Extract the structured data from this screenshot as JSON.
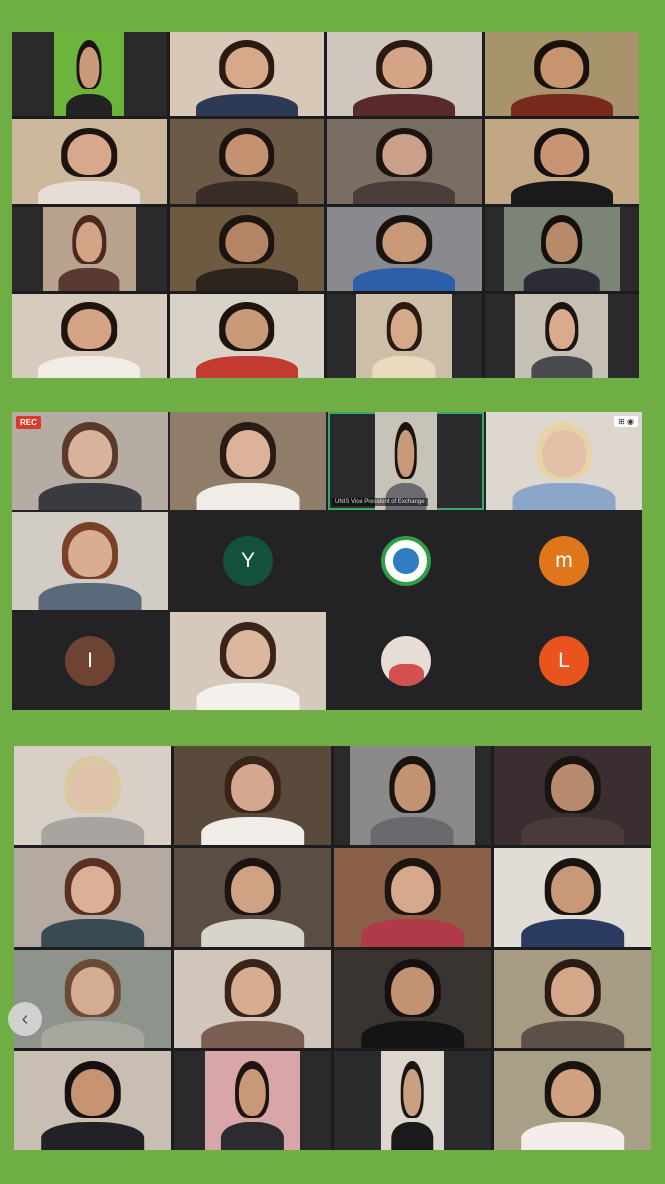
{
  "panels": [
    {
      "tiles": [
        {
          "bg": "#2a2a2c",
          "frame": "#6db43c",
          "skin": "#c99a7a",
          "hair": "#1a1410",
          "shirt": "#222",
          "frame_w": "45%"
        },
        {
          "bg": "#d9c8b8",
          "skin": "#d7a88a",
          "hair": "#2a1a12",
          "shirt": "#2c3a55"
        },
        {
          "bg": "#cfc6bd",
          "skin": "#d5a487",
          "hair": "#2b1a12",
          "shirt": "#5a2a2a"
        },
        {
          "bg": "#a8946c",
          "skin": "#c6946e",
          "hair": "#18110c",
          "shirt": "#7a2a1c"
        },
        {
          "bg": "#cdb89e",
          "skin": "#d8a88c",
          "hair": "#1e140e",
          "shirt": "#e6ded6"
        },
        {
          "bg": "#6b5a47",
          "skin": "#c49271",
          "hair": "#1a130f",
          "shirt": "#3a2c26"
        },
        {
          "bg": "#7a6d64",
          "skin": "#caa08a",
          "hair": "#1c140f",
          "shirt": "#4a3d3a"
        },
        {
          "bg": "#c2a784",
          "skin": "#c89574",
          "hair": "#161010",
          "shirt": "#1a1a1a"
        },
        {
          "bg": "#2a2a2c",
          "frame": "#b9a38f",
          "skin": "#d4a487",
          "hair": "#4a2a1c",
          "shirt": "#5a3a30",
          "frame_w": "60%"
        },
        {
          "bg": "#6e5a40",
          "skin": "#b48564",
          "hair": "#1b140f",
          "shirt": "#2e241e"
        },
        {
          "bg": "#8a8a8e",
          "skin": "#c99878",
          "hair": "#1a1410",
          "shirt": "#2c5fa8"
        },
        {
          "bg": "#2a2a2c",
          "frame": "#7c8478",
          "skin": "#b88a6a",
          "hair": "#14100c",
          "shirt": "#2b2c36",
          "frame_w": "75%"
        },
        {
          "bg": "#d7cbbd",
          "skin": "#d5a386",
          "hair": "#1f1510",
          "shirt": "#f2ece6"
        },
        {
          "bg": "#d8d2c8",
          "skin": "#c99a78",
          "hair": "#1c140f",
          "shirt": "#c23a30"
        },
        {
          "bg": "#2a2a2c",
          "frame": "#cdbfa8",
          "skin": "#d7a98b",
          "hair": "#2a1a12",
          "shirt": "#e8dcc0",
          "frame_w": "62%"
        },
        {
          "bg": "#2a2a2c",
          "frame": "#c6c0b4",
          "skin": "#d8aa8e",
          "hair": "#1c1410",
          "shirt": "#4a4a4e",
          "frame_w": "60%"
        }
      ]
    },
    {
      "rec_label": "REC",
      "vp_caption": "UNIS Vice President of Exchange",
      "tiles": [
        {
          "kind": "video",
          "bg": "#b5aca3",
          "skin": "#d8b29c",
          "hair": "#5a3a2a",
          "shirt": "#3a3a40",
          "rec": true
        },
        {
          "kind": "video",
          "bg": "#8f7d6a",
          "skin": "#dcb39a",
          "hair": "#2a1c14",
          "shirt": "#f0ece6"
        },
        {
          "kind": "video",
          "bg": "#2a2a2c",
          "frame": "#c7c3b9",
          "skin": "#c99a7a",
          "hair": "#1a1410",
          "shirt": "#6a6a70",
          "frame_w": "40%",
          "highlight": true,
          "caption": true
        },
        {
          "kind": "video",
          "bg": "#ddd7cf",
          "skin": "#e2c0a8",
          "hair": "#e6d3a8",
          "shirt": "#8aa6c8",
          "icons": "⊞ ◉"
        },
        {
          "kind": "video",
          "bg": "#d1ccc4",
          "skin": "#d9ad92",
          "hair": "#7a4028",
          "shirt": "#5a6a7a"
        },
        {
          "kind": "avatar",
          "letter": "Y",
          "color": "#14513a"
        },
        {
          "kind": "logo",
          "ring": "#2f9f46",
          "inner": "#2f7fc0"
        },
        {
          "kind": "avatar",
          "letter": "m",
          "color": "#e0761a"
        },
        {
          "kind": "avatar",
          "letter": "I",
          "color": "#6e4332"
        },
        {
          "kind": "video",
          "bg": "#d6c9bc",
          "skin": "#dcb69e",
          "hair": "#3a241a",
          "shirt": "#f4f0ec"
        },
        {
          "kind": "photo",
          "inner": "#d45050"
        },
        {
          "kind": "avatar",
          "letter": "L",
          "color": "#e8531e"
        }
      ]
    },
    {
      "back_icon": "‹",
      "tiles": [
        {
          "bg": "#d8d0c6",
          "skin": "#e0c2ac",
          "hair": "#d9c8a0",
          "shirt": "#a8a4a0"
        },
        {
          "bg": "#5a4a3c",
          "skin": "#d4a88e",
          "hair": "#3a2418",
          "shirt": "#f0ece8"
        },
        {
          "bg": "#2a2a2c",
          "frame": "#8c8a88",
          "skin": "#c29474",
          "hair": "#1a1410",
          "shirt": "#6a6a6e",
          "frame_w": "80%"
        },
        {
          "bg": "#3a2e30",
          "skin": "#b88a6e",
          "hair": "#1a1410",
          "shirt": "#4a3a3a"
        },
        {
          "bg": "#b4aaa2",
          "skin": "#dcb096",
          "hair": "#5a3020",
          "shirt": "#3a4a54"
        },
        {
          "bg": "#5a4e44",
          "skin": "#d0a284",
          "hair": "#1c1410",
          "shirt": "#d8d4cc"
        },
        {
          "bg": "#8a6048",
          "skin": "#d6a88c",
          "hair": "#1e1410",
          "shirt": "#b03a48"
        },
        {
          "bg": "#e2dcd6",
          "skin": "#c89878",
          "hair": "#1a1410",
          "shirt": "#2a3a60"
        },
        {
          "bg": "#8e948c",
          "skin": "#d4ac94",
          "hair": "#6a4a34",
          "shirt": "#a6a8a0"
        },
        {
          "bg": "#d0c6bc",
          "skin": "#d8ac90",
          "hair": "#3a2418",
          "shirt": "#7a5e52"
        },
        {
          "bg": "#3a3430",
          "skin": "#c29272",
          "hair": "#161010",
          "shirt": "#141414"
        },
        {
          "bg": "#a89c84",
          "skin": "#d2a888",
          "hair": "#2a1c14",
          "shirt": "#5c5048"
        },
        {
          "bg": "#c8beb2",
          "skin": "#c69472",
          "hair": "#161010",
          "shirt": "#222226"
        },
        {
          "bg": "#2a2a2c",
          "frame": "#d8a6a8",
          "skin": "#c89878",
          "hair": "#1c1410",
          "shirt": "#2c2c30",
          "frame_w": "60%"
        },
        {
          "bg": "#2a2a2c",
          "frame": "#dcd6ce",
          "skin": "#caa082",
          "hair": "#1c1410",
          "shirt": "#1a1a1a",
          "frame_w": "40%"
        },
        {
          "bg": "#a8a086",
          "skin": "#d0a080",
          "hair": "#1a1410",
          "shirt": "#f4ece8"
        }
      ]
    }
  ]
}
